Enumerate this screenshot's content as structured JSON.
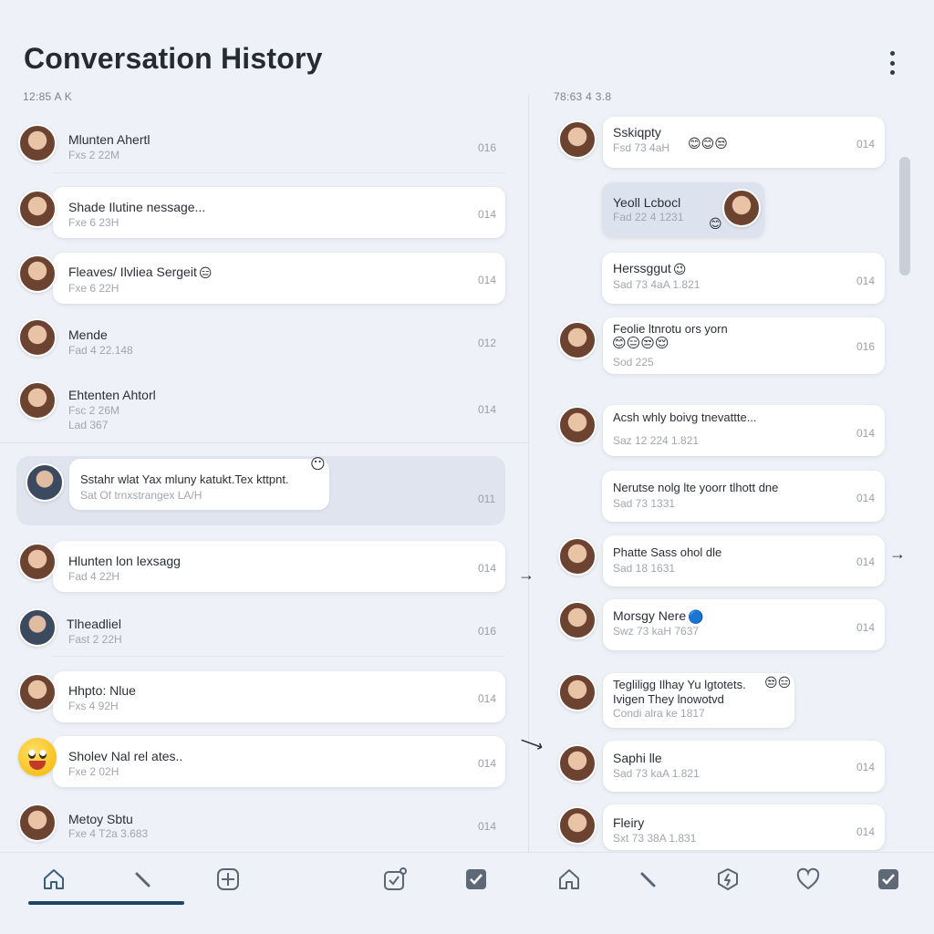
{
  "header": {
    "title": "Conversation History",
    "left_stamp": "12:85 A K",
    "right_stamp": "78:63 4 3.8"
  },
  "left_list": [
    {
      "name": "Mlunten Ahertl",
      "meta": "Fxs 2 22M",
      "count": "016",
      "avatar": "woman"
    },
    {
      "name": "Shade Ilutine nessage...",
      "meta": "Fxe 6 23H",
      "count": "014",
      "avatar": "woman"
    },
    {
      "name": "Fleaves/ Ilvliea Sergeit",
      "emoji": "😑",
      "meta": "Fxe 6 22H",
      "count": "014",
      "avatar": "woman"
    },
    {
      "name": "Mende",
      "meta": "Fad 4 22.148",
      "count": "012",
      "avatar": "woman"
    },
    {
      "name": "Ehtenten Ahtorl",
      "meta": "Fsc 2 26M",
      "meta2": "Lad 367",
      "count": "014",
      "avatar": "woman"
    }
  ],
  "selected": {
    "name": "Sstahr wlat Yax mluny katukt.Tex kttpnt.",
    "meta": "Sat Of trnxstrangex LA/H",
    "count": "011",
    "emoji": "😶"
  },
  "left_list2": [
    {
      "name": "Hlunten lon lexsagg",
      "meta": "Fad 4 22H",
      "count": "014",
      "avatar": "woman"
    },
    {
      "name": "Tlheadliel",
      "meta": "Fast 2 22H",
      "count": "016",
      "avatar": "man"
    },
    {
      "name": "Hhpto: Nlue",
      "meta": "Fxs 4 92H",
      "count": "014",
      "avatar": "woman"
    },
    {
      "name": "Sholev Nal rel ates..",
      "meta": "Fxe 2 02H",
      "count": "014",
      "avatar": "emoji"
    },
    {
      "name": "Metoy Sbtu",
      "meta": "Fxe 4 T2a 3.683",
      "count": "014",
      "avatar": "woman"
    }
  ],
  "right_list": [
    {
      "name": "Sskiqpty",
      "emoji": "😊😊😒",
      "meta": "Fsd 73 4aH",
      "count": "014"
    },
    {
      "name": "Yeoll Lcbocl",
      "meta": "Fad 22 4 1231",
      "emoji": "😊",
      "highlight": true
    },
    {
      "name": "Herssggut",
      "emoji": "😉",
      "meta": "Sad 73 4aA 1.821",
      "count": "014"
    },
    {
      "name": "Feolie ltnrotu ors yorn",
      "emoji": "😊😑😒😌",
      "meta": "Sod 225",
      "count": "016"
    },
    {
      "name": "Acsh whly boivg tnevattte...",
      "meta": "Saz 12 224 1.821",
      "count": "014"
    },
    {
      "name": "Nerutse nolg lte yoorr tlhott dne",
      "meta": "Sad 73 1331",
      "count": "014",
      "no_avatar": true
    },
    {
      "name": "Phatte Sass ohol dle",
      "meta": "Sad 18 1631",
      "count": "014"
    },
    {
      "name": "Morsgy Nere",
      "emoji": "🔵",
      "meta": "Swz 73 kaH 7637",
      "count": "014"
    },
    {
      "name": "Tegliligg Ilhay Yu lgtotets.",
      "name2": "Ivigen They lnowotvd",
      "emoji": "😒😑",
      "meta": "Condi alra ke 1817"
    },
    {
      "name": "Saphi lle",
      "meta": "Sad 73 kaA 1.821",
      "count": "014"
    },
    {
      "name": "Fleiry",
      "meta": "Sxt 73 38A 1.831",
      "count": "014"
    }
  ],
  "nav": {
    "left": [
      "home-icon",
      "pencil-icon",
      "plus-square-icon",
      "calendar-check-icon",
      "checkbox-icon"
    ],
    "right": [
      "home-icon",
      "pencil-icon",
      "lightning-shield-icon",
      "heart-icon",
      "checkbox-icon"
    ]
  },
  "colors": {
    "background": "#eef1f7",
    "accent": "#1f4763",
    "selected": "#dfe4ee"
  }
}
